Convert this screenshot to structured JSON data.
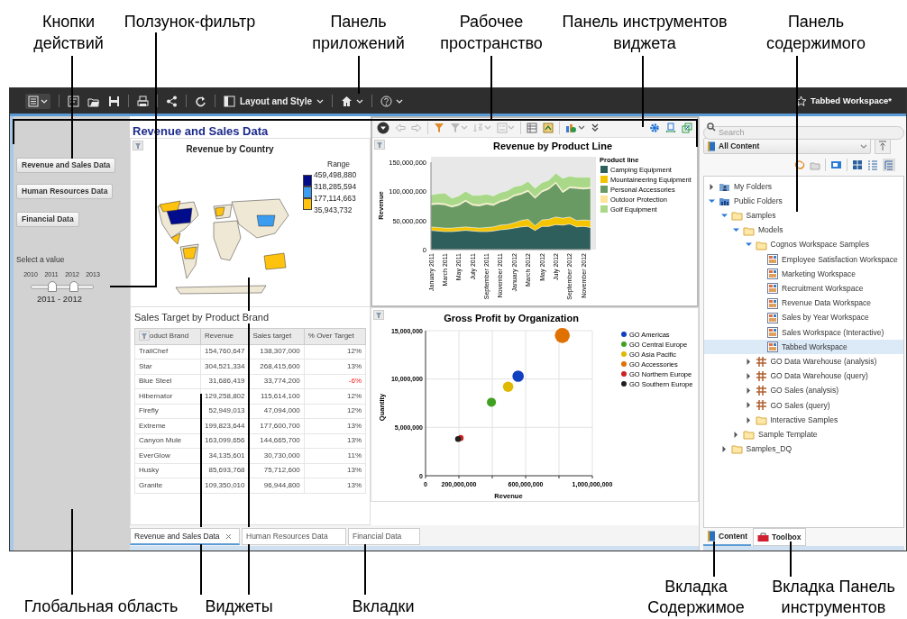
{
  "callouts_top": [
    {
      "text": "Кнопки\nдействий"
    },
    {
      "text": "Ползунок-фильтр"
    },
    {
      "text": "Панель\nприложений"
    },
    {
      "text": "Рабочее\nпространство"
    },
    {
      "text": "Панель инструментов\nвиджета"
    },
    {
      "text": "Панель\nсодержимого"
    }
  ],
  "callouts_bottom": [
    {
      "text": "Глобальная область"
    },
    {
      "text": "Виджеты"
    },
    {
      "text": "Вкладки"
    },
    {
      "text": "Вкладка\nСодержимое"
    },
    {
      "text": "Вкладка Панель\nинструментов"
    }
  ],
  "app_toolbar": {
    "layout_menu": "Layout and Style",
    "workspace_name": "Tabbed Workspace*"
  },
  "global_area": {
    "buttons": [
      "Revenue and Sales Data",
      "Human Resources Data",
      "Financial Data"
    ],
    "slider": {
      "label": "Select a value",
      "ticks": [
        "2010",
        "2011",
        "2012",
        "2013"
      ],
      "thumbs": [
        {
          "level": 0.333
        },
        {
          "level": 0.667
        }
      ],
      "value": "2011 - 2012"
    }
  },
  "workspace": {
    "title": "Revenue and Sales Data",
    "map_widget": {
      "title": "Revenue by Country",
      "legend_title": "Range",
      "legend_labels": [
        "459,498,880",
        "318,285,594",
        "177,114,663",
        "35,943,732"
      ],
      "swatches": [
        {
          "color": "#000c8c"
        },
        {
          "color": "#3b9cf0"
        },
        {
          "color": "#ffc20e"
        }
      ]
    },
    "area_widget": {
      "chart_data": {
        "type": "area",
        "title": "Revenue by Product Line",
        "ylabel": "Revenue",
        "stacked": true,
        "categories": [
          "January 2011",
          null,
          "March 2011",
          null,
          "May 2011",
          null,
          "July 2011",
          null,
          "September 2011",
          null,
          "November 2011",
          null,
          "January 2012",
          null,
          "March 2012",
          null,
          "May 2012",
          null,
          "July 2012",
          null,
          "September 2012",
          null,
          "November 2012",
          null
        ],
        "ylim": [
          0,
          150000000
        ],
        "yticks": [
          {
            "value": 0,
            "label": "0"
          },
          {
            "value": 50000000,
            "label": "50,000,000"
          },
          {
            "value": 100000000,
            "label": "100,000,000"
          },
          {
            "value": 150000000,
            "label": "150,000,000"
          }
        ],
        "legend_title": "Product line",
        "legend": true,
        "series": [
          {
            "name": "Camping Equipment",
            "color": "#2f5f5c",
            "values": [
              33000000,
              32000000,
              31000000,
              31000000,
              32000000,
              33000000,
              32000000,
              31000000,
              31000000,
              32000000,
              34000000,
              35000000,
              37000000,
              39000000,
              40000000,
              33000000,
              40000000,
              40000000,
              43000000,
              42000000,
              44000000,
              39000000,
              40000000,
              38000000
            ]
          },
          {
            "name": "Mountaineering Equipment",
            "color": "#f5c400",
            "values": [
              6000000,
              6000000,
              6000000,
              6000000,
              6000000,
              6000000,
              6000000,
              6000000,
              7000000,
              7000000,
              8000000,
              8000000,
              9000000,
              11000000,
              12000000,
              8000000,
              11000000,
              12000000,
              13000000,
              12000000,
              12000000,
              11000000,
              11000000,
              12000000
            ]
          },
          {
            "name": "Personal Accessories",
            "color": "#6a9a64",
            "values": [
              38000000,
              40000000,
              40000000,
              36000000,
              38000000,
              44000000,
              38000000,
              38000000,
              40000000,
              37000000,
              40000000,
              42000000,
              46000000,
              45000000,
              48000000,
              47000000,
              48000000,
              52000000,
              58000000,
              44000000,
              50000000,
              55000000,
              53000000,
              55000000
            ]
          },
          {
            "name": "Outdoor Protection",
            "color": "#fde59a",
            "values": [
              2000000,
              2000000,
              2000000,
              2000000,
              2000000,
              2000000,
              2000000,
              2000000,
              2000000,
              2000000,
              2000000,
              2000000,
              2000000,
              2000000,
              2000000,
              2000000,
              2000000,
              2000000,
              2000000,
              2000000,
              2000000,
              2000000,
              2000000,
              2000000
            ]
          },
          {
            "name": "Golf Equipment",
            "color": "#a8d888",
            "values": [
              15000000,
              16000000,
              18000000,
              13000000,
              14000000,
              15000000,
              15000000,
              16000000,
              15000000,
              14000000,
              14000000,
              14000000,
              14000000,
              13000000,
              15000000,
              15000000,
              14000000,
              13000000,
              15000000,
              22000000,
              18000000,
              17000000,
              18000000,
              17000000
            ]
          }
        ]
      }
    },
    "table_widget": {
      "title": "Sales Target by Product Brand",
      "columns": [
        "oduct Brand",
        "Revenue",
        "Sales target",
        "% Over Target"
      ],
      "rows": [
        {
          "cells": [
            "TrailChef",
            "154,760,647",
            "138,307,000",
            "12%"
          ],
          "below_target": false
        },
        {
          "cells": [
            "Star",
            "304,521,334",
            "268,415,600",
            "13%"
          ],
          "below_target": false
        },
        {
          "cells": [
            "Blue Steel",
            "31,686,419",
            "33,774,200",
            "-6%"
          ],
          "below_target": true
        },
        {
          "cells": [
            "Hibernator",
            "129,258,802",
            "115,614,100",
            "12%"
          ],
          "below_target": false
        },
        {
          "cells": [
            "Firefly",
            "52,949,013",
            "47,094,000",
            "12%"
          ],
          "below_target": false
        },
        {
          "cells": [
            "Extreme",
            "199,823,644",
            "177,600,700",
            "13%"
          ],
          "below_target": false
        },
        {
          "cells": [
            "Canyon Mule",
            "163,099,656",
            "144,665,700",
            "13%"
          ],
          "below_target": false
        },
        {
          "cells": [
            "EverGlow",
            "34,135,601",
            "30,730,000",
            "11%"
          ],
          "below_target": false
        },
        {
          "cells": [
            "Husky",
            "85,693,768",
            "75,712,600",
            "13%"
          ],
          "below_target": false
        },
        {
          "cells": [
            "Granite",
            "109,350,010",
            "96,944,800",
            "13%"
          ],
          "below_target": false
        }
      ]
    },
    "scatter_widget": {
      "chart_data": {
        "type": "scatter",
        "title": "Gross Profit by Organization",
        "xlabel": "Revenue",
        "ylabel": "Quantity",
        "grid": true,
        "legend": true,
        "xlim": [
          0,
          1000000000
        ],
        "ylim": [
          0,
          15000000
        ],
        "xticks": [
          {
            "value": 0,
            "label": "0"
          },
          {
            "value": 200000000,
            "label": "200,000,000"
          },
          {
            "value": 600000000,
            "label": "600,000,000"
          },
          {
            "value": 1000000000,
            "label": "1,000,000,000"
          }
        ],
        "yticks": [
          {
            "value": 0,
            "label": "0"
          },
          {
            "value": 5000000,
            "label": "5,000,000"
          },
          {
            "value": 10000000,
            "label": "10,000,000"
          },
          {
            "value": 15000000,
            "label": "15,000,000"
          }
        ],
        "series": [
          {
            "name": "GO Americas",
            "color": "#1040c0",
            "x": [
              555000000
            ],
            "values": [
              10300000
            ]
          },
          {
            "name": "GO Central Europe",
            "color": "#40a020",
            "x": [
              395000000
            ],
            "values": [
              7600000
            ]
          },
          {
            "name": "GO Asia Pacific",
            "color": "#e0b800",
            "x": [
              495000000
            ],
            "values": [
              9200000
            ]
          },
          {
            "name": "GO Accessories",
            "color": "#e07000",
            "x": [
              820000000
            ],
            "values": [
              14500000
            ]
          },
          {
            "name": "GO Northern Europe",
            "color": "#d02020",
            "x": [
              210000000
            ],
            "values": [
              3900000
            ]
          },
          {
            "name": "GO Southern Europe",
            "color": "#202020",
            "x": [
              195000000
            ],
            "values": [
              3800000
            ]
          }
        ]
      }
    },
    "tabs": [
      {
        "label": "Revenue and Sales Data",
        "selected": true
      },
      {
        "label": "Human Resources Data",
        "selected": false
      },
      {
        "label": "Financial Data",
        "selected": false
      }
    ]
  },
  "content_pane": {
    "search": {
      "placeholder": "Search"
    },
    "source": "All Content",
    "tree": [
      {
        "label": "My Folders",
        "kind": "my-folders",
        "expanded": false,
        "selected": false
      },
      {
        "label": "Public Folders",
        "kind": "public-folders",
        "expanded": true,
        "selected": false,
        "children": [
          {
            "label": "Samples",
            "kind": "folder",
            "expanded": true,
            "selected": false,
            "children": [
              {
                "label": "Models",
                "kind": "folder",
                "expanded": true,
                "selected": false,
                "children": [
                  {
                    "label": "Cognos Workspace Samples",
                    "kind": "folder",
                    "expanded": true,
                    "selected": false,
                    "children": [
                      {
                        "label": "Employee Satisfaction Workspace",
                        "kind": "workspace",
                        "selected": false
                      },
                      {
                        "label": "Marketing Workspace",
                        "kind": "workspace",
                        "selected": false
                      },
                      {
                        "label": "Recruitment Workspace",
                        "kind": "workspace",
                        "selected": false
                      },
                      {
                        "label": "Revenue Data Workspace",
                        "kind": "workspace",
                        "selected": false
                      },
                      {
                        "label": "Sales by Year Workspace",
                        "kind": "workspace",
                        "selected": false
                      },
                      {
                        "label": "Sales Workspace (Interactive)",
                        "kind": "workspace",
                        "selected": false
                      },
                      {
                        "label": "Tabbed Workspace",
                        "kind": "workspace",
                        "selected": true
                      }
                    ]
                  },
                  {
                    "label": "GO Data Warehouse (analysis)",
                    "kind": "package",
                    "expanded": false,
                    "selected": false
                  },
                  {
                    "label": "GO Data Warehouse (query)",
                    "kind": "package",
                    "expanded": false,
                    "selected": false
                  },
                  {
                    "label": "GO Sales (analysis)",
                    "kind": "package",
                    "expanded": false,
                    "selected": false
                  },
                  {
                    "label": "GO Sales (query)",
                    "kind": "package",
                    "expanded": false,
                    "selected": false
                  },
                  {
                    "label": "Interactive Samples",
                    "kind": "folder",
                    "expanded": false,
                    "selected": false
                  }
                ]
              },
              {
                "label": "Sample Template",
                "kind": "folder",
                "expanded": false,
                "selected": false
              }
            ]
          },
          {
            "label": "Samples_DQ",
            "kind": "folder",
            "expanded": false,
            "selected": false
          }
        ]
      }
    ],
    "tabs": [
      {
        "label": "Content",
        "kind": "content",
        "selected": true
      },
      {
        "label": "Toolbox",
        "kind": "toolbox",
        "selected": false
      }
    ]
  }
}
